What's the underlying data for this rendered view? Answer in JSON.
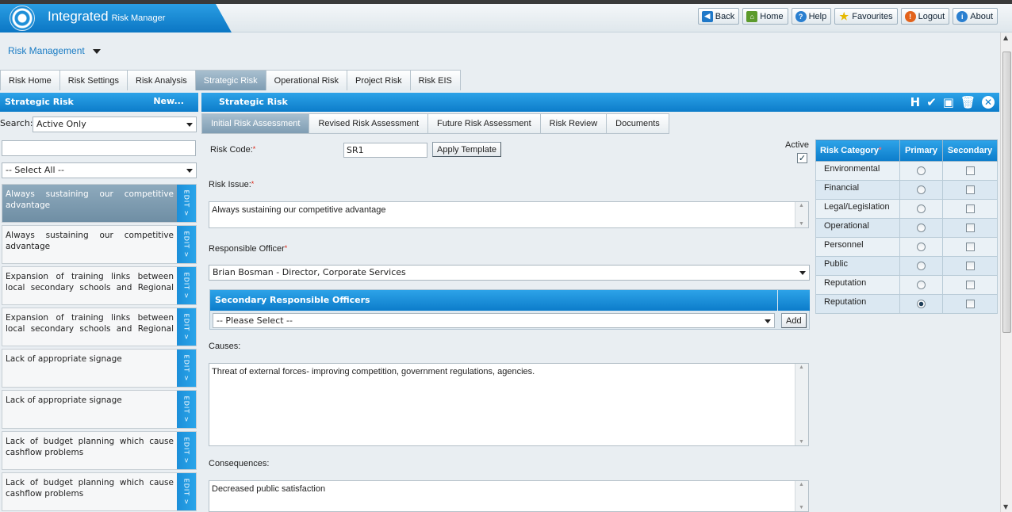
{
  "app": {
    "title": "Integrated",
    "subtitle": "Risk Manager"
  },
  "header_buttons": [
    {
      "label": "Back",
      "icon": "back-arrow-icon"
    },
    {
      "label": "Home",
      "icon": "home-icon"
    },
    {
      "label": "Help",
      "icon": "help-icon"
    },
    {
      "label": "Favourites",
      "icon": "star-icon"
    },
    {
      "label": "Logout",
      "icon": "logout-icon"
    },
    {
      "label": "About",
      "icon": "about-icon"
    }
  ],
  "module": {
    "label": "Risk Management"
  },
  "main_tabs": [
    "Risk Home",
    "Risk Settings",
    "Risk Analysis",
    "Strategic Risk",
    "Operational Risk",
    "Project Risk",
    "Risk EIS"
  ],
  "main_tab_active": "Strategic Risk",
  "left_panel": {
    "title": "Strategic Risk",
    "new_label": "New...",
    "search_label": "Search:",
    "filter_value": "Active Only",
    "search_value": "",
    "select_all_value": "-- Select All --",
    "edit_label": "EDIT >",
    "items": [
      "Always sustaining our competitive advantage",
      "Always sustaining our competitive advantage",
      "Expansion of training links between local secondary schools and Regional Develop...",
      "Expansion of training links between local secondary schools and Regional Develop...",
      "Lack of appropriate signage",
      "Lack of appropriate signage",
      "Lack of budget planning which cause cashflow problems",
      "Lack of budget planning which cause cashflow problems"
    ]
  },
  "form": {
    "title": "Strategic Risk",
    "sub_tabs": [
      "Initial Risk Assessment",
      "Revised Risk Assessment",
      "Future Risk Assessment",
      "Risk Review",
      "Documents"
    ],
    "risk_code_label": "Risk Code:",
    "risk_code_value": "SR1",
    "apply_template_label": "Apply Template",
    "active_label": "Active",
    "active_checked": true,
    "risk_issue_label": "Risk Issue:",
    "risk_issue_value": "Always sustaining our competitive advantage",
    "responsible_officer_label": "Responsible Officer",
    "responsible_officer_value": "Brian Bosman - Director, Corporate Services",
    "secondary_officers_label": "Secondary Responsible Officers",
    "secondary_officers_placeholder": "-- Please Select --",
    "add_label": "Add",
    "causes_label": "Causes:",
    "causes_value": "Threat of external forces- improving competition, government regulations, agencies.",
    "consequences_label": "Consequences:",
    "consequences_value": "Decreased public satisfaction"
  },
  "risk_category": {
    "headers": [
      "Risk Category",
      "Primary",
      "Secondary"
    ],
    "rows": [
      {
        "name": "Environmental",
        "primary": false,
        "secondary": false
      },
      {
        "name": "Financial",
        "primary": false,
        "secondary": false
      },
      {
        "name": "Legal/Legislation",
        "primary": false,
        "secondary": false
      },
      {
        "name": "Operational",
        "primary": false,
        "secondary": false
      },
      {
        "name": "Personnel",
        "primary": false,
        "secondary": false
      },
      {
        "name": "Public",
        "primary": false,
        "secondary": false
      },
      {
        "name": "Reputation",
        "primary": false,
        "secondary": false
      },
      {
        "name": "Reputation",
        "primary": true,
        "secondary": false
      }
    ]
  },
  "toolbar_icons": [
    "hierarchy-icon",
    "spellcheck-icon",
    "save-icon",
    "delete-icon",
    "close-icon"
  ],
  "colors": {
    "accent": "#0c7cca",
    "active_tab": "#7f9db3"
  }
}
